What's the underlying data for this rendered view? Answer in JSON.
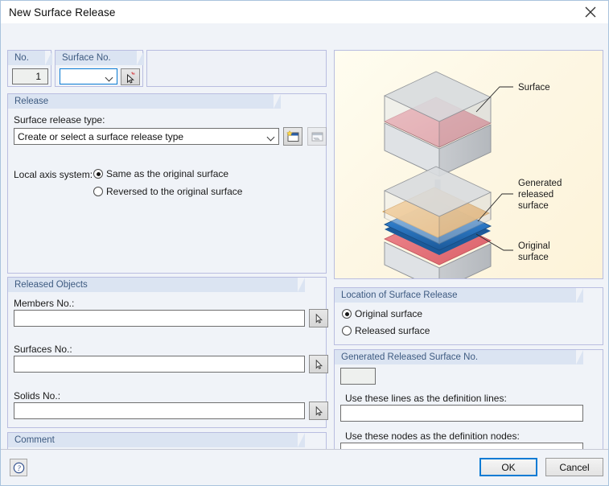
{
  "window": {
    "title": "New Surface Release",
    "close_icon": "close-icon"
  },
  "identification": {
    "no_label": "No.",
    "no_value": "1",
    "surface_no_label": "Surface No.",
    "surface_no_value": "",
    "surface_pick_icon": "pick-surface-icon"
  },
  "release": {
    "group_title": "Release",
    "type_label": "Surface release type:",
    "type_value": "Create or select a surface release type",
    "new_type_icon": "new-window-icon",
    "edit_type_icon": "edit-window-icon",
    "axis_label": "Local axis system:",
    "axis_options": [
      {
        "label": "Same as the original surface",
        "selected": true
      },
      {
        "label": "Reversed to the original surface",
        "selected": false
      }
    ]
  },
  "released_objects": {
    "group_title": "Released Objects",
    "members_label": "Members No.:",
    "members_value": "",
    "members_pick_icon": "pick-members-icon",
    "surfaces_label": "Surfaces No.:",
    "surfaces_value": "",
    "surfaces_pick_icon": "pick-surfaces-icon",
    "solids_label": "Solids No.:",
    "solids_value": "",
    "solids_pick_icon": "pick-solids-icon"
  },
  "comment": {
    "group_title": "Comment",
    "value": "",
    "library_icon": "comment-library-icon"
  },
  "location": {
    "group_title": "Location of Surface Release",
    "options": [
      {
        "label": "Original surface",
        "selected": true
      },
      {
        "label": "Released surface",
        "selected": false
      }
    ]
  },
  "generated": {
    "group_title": "Generated Released Surface No.",
    "number_value": "",
    "lines_label": "Use these lines as the definition lines:",
    "lines_value": "",
    "nodes_label": "Use these nodes as the definition nodes:",
    "nodes_value": ""
  },
  "illustration": {
    "annotations": {
      "surface": "Surface",
      "generated_line1": "Generated",
      "generated_line2": "released",
      "generated_line3": "surface",
      "original_line1": "Original",
      "original_line2": "surface"
    },
    "colors": {
      "surface_red": "#e8737b",
      "generated_orange": "#f3b15a",
      "released_blue": "#2c78c4",
      "original_red": "#e8737b",
      "solid_gray": "#d3d5d8",
      "panel_bg": "#fdf6e2"
    }
  },
  "footer": {
    "help_icon": "help-icon",
    "ok_label": "OK",
    "cancel_label": "Cancel"
  }
}
